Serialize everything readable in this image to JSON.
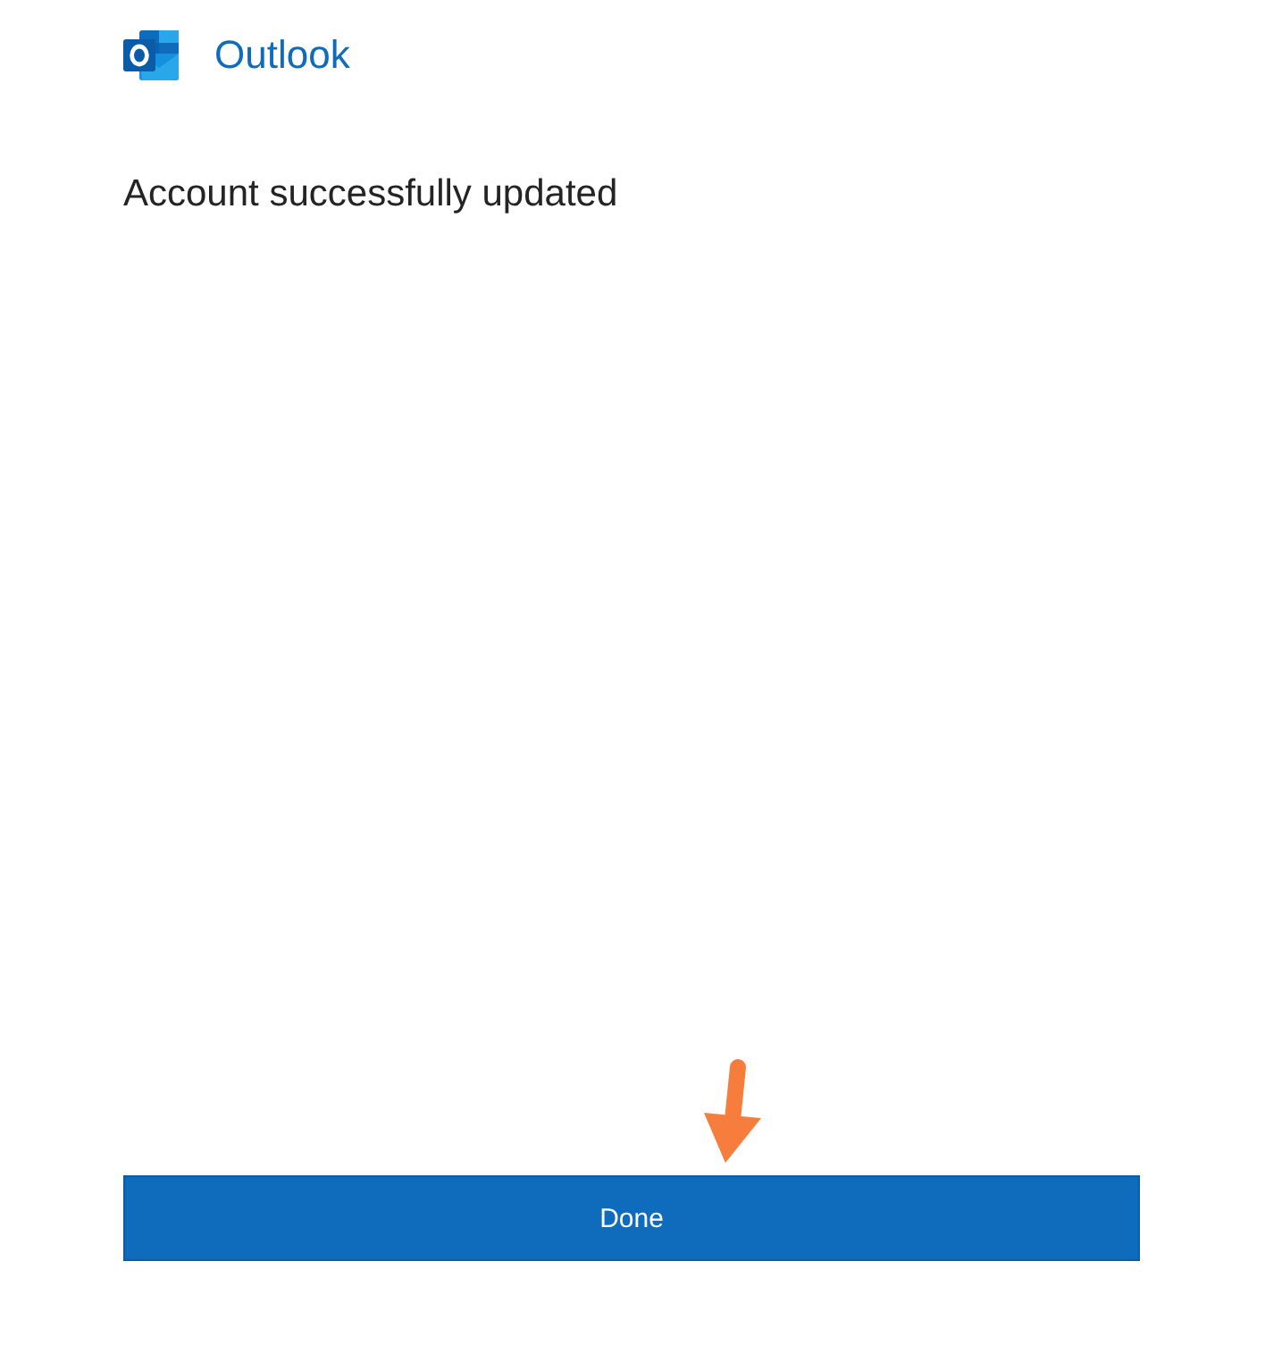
{
  "header": {
    "app_name": "Outlook"
  },
  "message": "Account successfully updated",
  "buttons": [
    {
      "label": "Done"
    }
  ]
}
